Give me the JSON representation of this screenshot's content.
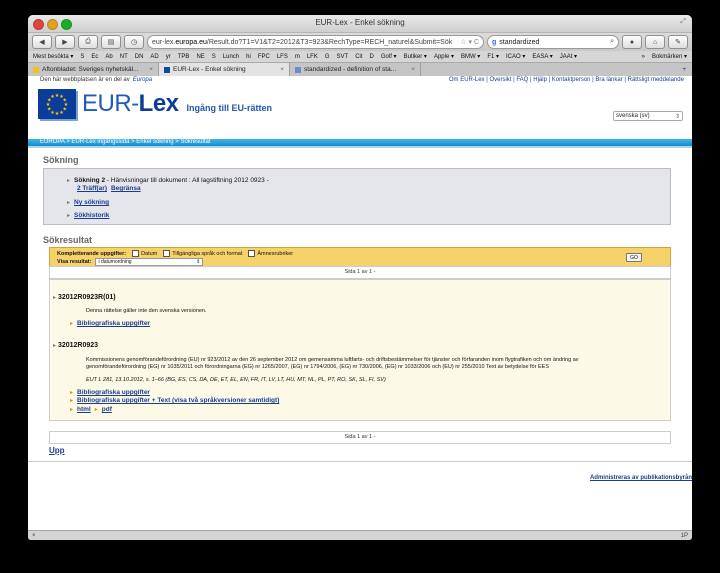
{
  "window": {
    "title": "EUR-Lex - Enkel sökning"
  },
  "nav": {
    "url_prefix": "eur-lex.",
    "url_domain": "europa.eu",
    "url_rest": "/Result.do?T1=V1&T2=2012&T3=923&RechType=RECH_naturel&Submit=Sök",
    "url_tail": "☆ ▾ C",
    "search_value": "standardized"
  },
  "bookmarks": {
    "items": [
      "Mest besökta ▾",
      "S",
      "Ec",
      "Ab",
      "NT",
      "DN",
      "AD",
      "yr",
      "TPB",
      "NE",
      "S",
      "Lunch",
      "hi",
      "FPC",
      "LFS",
      "m",
      "LFK",
      "G",
      "SVT",
      "Cit",
      "D",
      "Golf ▾",
      "Butiker ▾",
      "Apple ▾",
      "BMW ▾",
      "F1 ▾",
      "ICAO ▾",
      "EASA ▾",
      "JAAt ▾"
    ],
    "more": "»",
    "folder": "Bokmärken ▾"
  },
  "tabs": [
    {
      "label": "Aftonbladet: Sveriges nyhetskäl..."
    },
    {
      "label": "EUR-Lex - Enkel sökning"
    },
    {
      "label": "standardized - definition of sta..."
    }
  ],
  "header": {
    "site_note": "Den här webbplatsen är en del av",
    "site_note_brand": "Europa",
    "links": "Om EUR-Lex | Översikt | FAQ | Hjälp | Kontaktperson | Bra länkar | Rättsligt meddelande",
    "logo_eur": "EUR-",
    "logo_lex": "Lex",
    "tagline": "Ingång till EU-rätten",
    "language": "svenska (sv)"
  },
  "breadcrumb": "EUROPA > EUR-Lex ingångssida > Enkel sökning > Sökresultat",
  "search": {
    "heading": "Sökning",
    "line1_bold": "Sökning 2",
    "line1_rest": " - Hänvisningar till dokument : All lagstiftning 2012 0923 -",
    "hits": "2 Träff(ar)",
    "refine": "Begränsa",
    "new_search": "Ny sökning",
    "history": "Sökhistorik"
  },
  "results": {
    "heading": "Sökresultat",
    "options_label": "Kompletterande uppgifter:",
    "opt_date": "Datum",
    "opt_lang": "Tillgängliga språk och format",
    "opt_subject": "Ämnesrubriker",
    "display_label": "Visa resultat:",
    "display_value": "i datumordning",
    "go": "GO",
    "pager_top": "Sida 1   av   1 -",
    "pager_bottom": "Sida 1   av   1 -",
    "item1": {
      "id": "32012R0923R(01)",
      "note": "Denna rättelse gäller inte den svenska versionen.",
      "biblio": "Bibliografiska uppgifter"
    },
    "item2": {
      "id": "32012R0923",
      "desc": "Kommissionens genomförandeförordning (EU) nr 923/2012 av den 26 september 2012 om gemensamma luftfarts- och driftsbestämmelser för tjänster och förfaranden inom flygtrafiken och om ändring av genomförandeförordning (EG) nr 1035/2011 och förordningarna (EG) nr 1265/2007, (EG) nr 1794/2006, (EG) nr 730/2006, (EG) nr 1033/2006 och (EU) nr 255/2010 Text av betydelse för EES",
      "oj": "EUT L 281, 13.10.2012, s. 1–66 (BG, ES, CS, DA, DE, ET, EL, EN, FR, IT, LV, LT, HU, MT, NL, PL, PT, RO, SK, SL, FI, SV)",
      "biblio": "Bibliografiska uppgifter",
      "biblio_text": "Bibliografiska uppgifter + Text (visa två språkversioner samtidigt)",
      "html": "html",
      "pdf": "pdf"
    }
  },
  "upp": "Upp",
  "footer": {
    "admin": "Administreras av publikationsbyrån"
  },
  "status": {
    "left": "×",
    "right": "1P"
  }
}
